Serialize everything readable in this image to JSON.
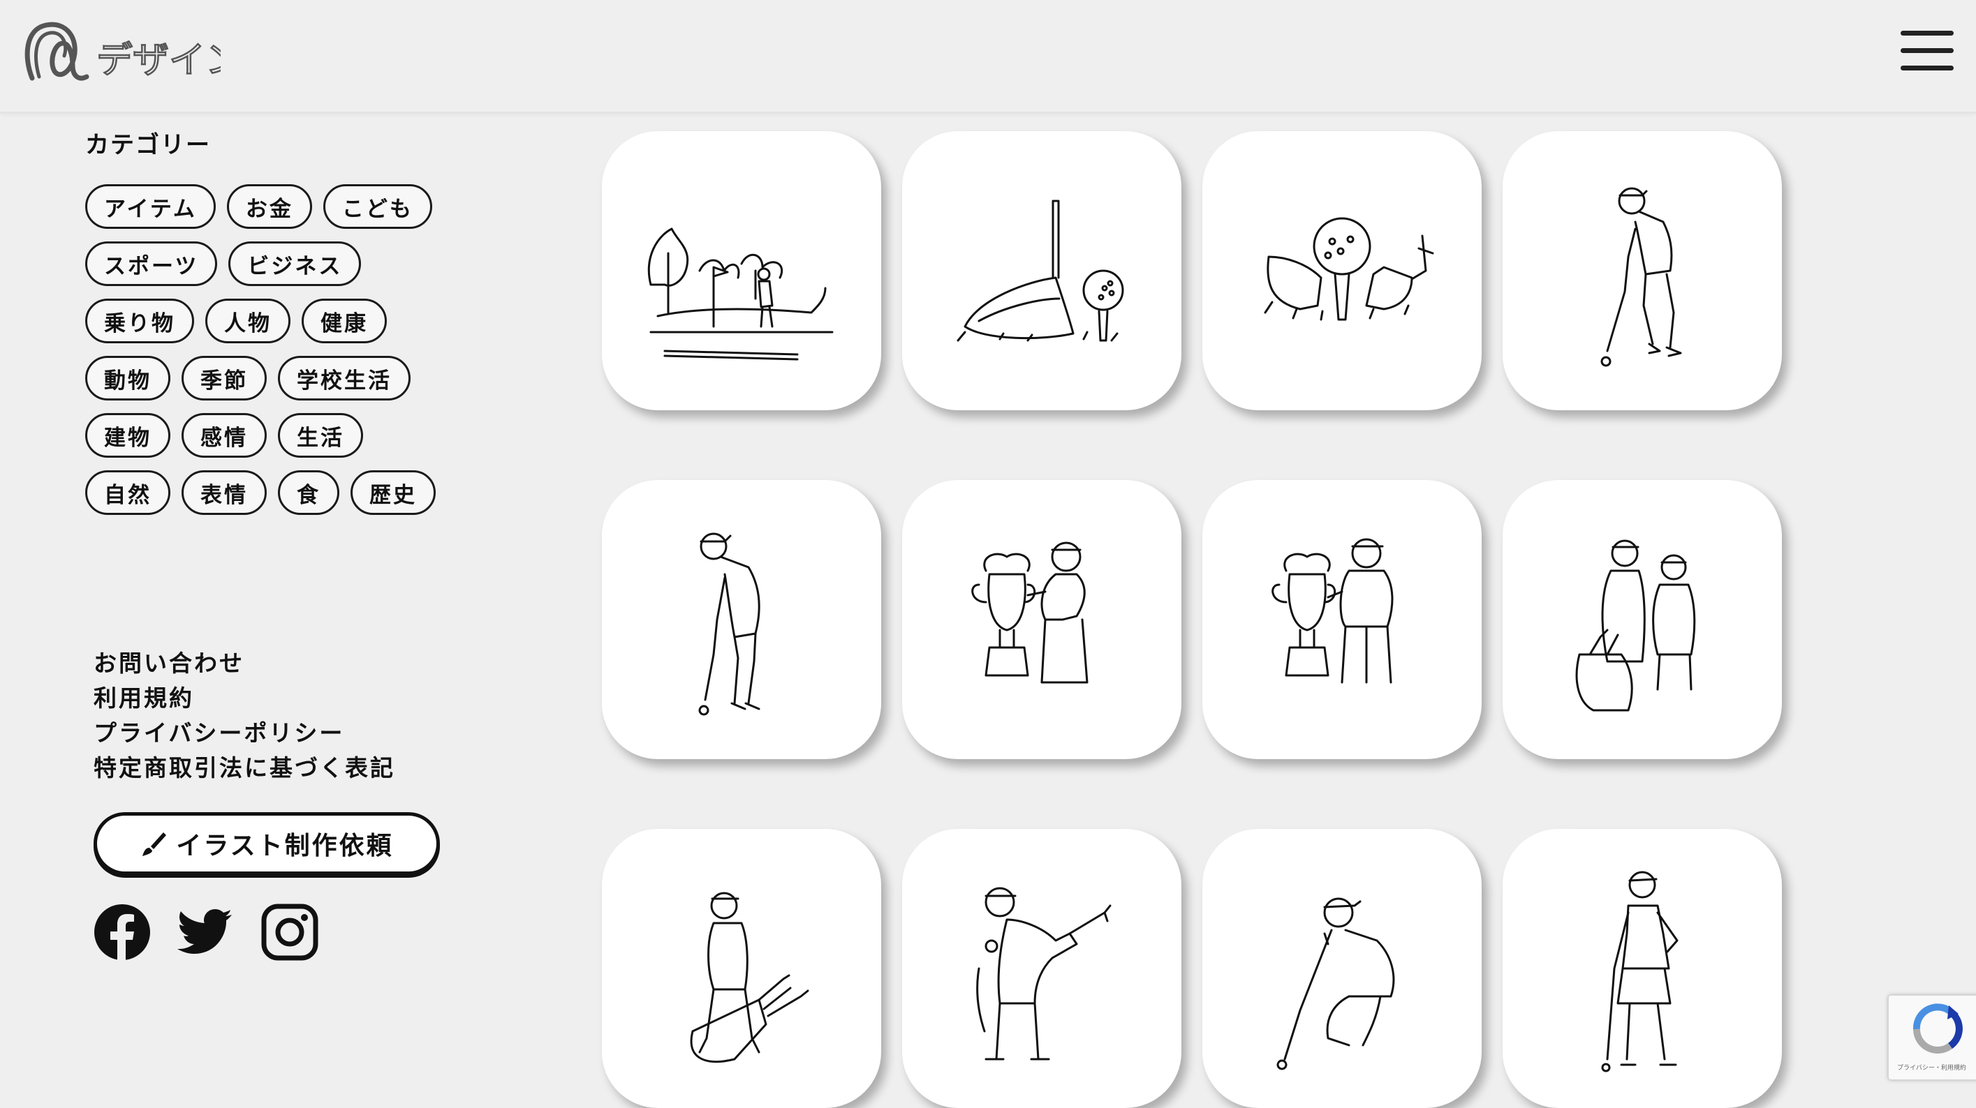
{
  "header": {
    "logo_text": "デザイン"
  },
  "sidebar": {
    "category_title": "カテゴリー",
    "tags": [
      [
        "アイテム",
        "お金",
        "こども"
      ],
      [
        "スポーツ",
        "ビジネス"
      ],
      [
        "乗り物",
        "人物",
        "健康"
      ],
      [
        "動物",
        "季節",
        "学校生活"
      ],
      [
        "建物",
        "感情",
        "生活"
      ],
      [
        "自然",
        "表情",
        "食",
        "歴史"
      ]
    ],
    "links": [
      "お問い合わせ",
      "利用規約",
      "プライバシーポリシー",
      "特定商取引法に基づく表記"
    ],
    "request_button": "イラスト制作依頼",
    "social": [
      "facebook-icon",
      "twitter-icon",
      "instagram-icon"
    ]
  },
  "gallery": {
    "items": [
      "golf-course-illustration",
      "golf-driver-ball-illustration",
      "golf-ball-on-tee-illustration",
      "golfer-putting-illustration",
      "golfer-putting-woman-illustration",
      "woman-with-trophy-illustration",
      "man-with-trophy-illustration",
      "golf-couple-illustration",
      "golfer-with-bag-illustration",
      "golfer-swinging-illustration",
      "golfer-reading-green-illustration",
      "woman-golfer-standing-illustration"
    ]
  },
  "recaptcha": {
    "footer_text": "プライバシー・利用規約"
  }
}
